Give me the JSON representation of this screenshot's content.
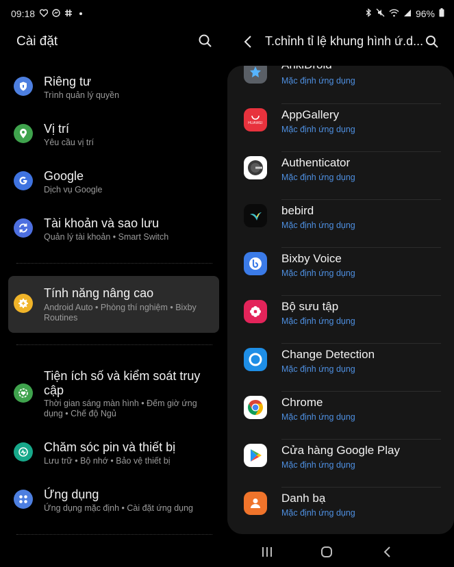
{
  "status": {
    "time": "09:18",
    "battery": "96%"
  },
  "left": {
    "title": "Cài đặt",
    "items": [
      {
        "title": "Riêng tư",
        "subtitle": "Trình quản lý quyền",
        "color": "#4d7fe0",
        "icon": "shield-icon"
      },
      {
        "title": "Vị trí",
        "subtitle": "Yêu cầu vị trí",
        "color": "#3fa34d",
        "icon": "location-pin-icon"
      },
      {
        "title": "Google",
        "subtitle": "Dịch vụ Google",
        "color": "#3f73e0",
        "icon": "google-icon"
      },
      {
        "title": "Tài khoản và sao lưu",
        "subtitle": "Quản lý tài khoản  •  Smart Switch",
        "color": "#4d6fe0",
        "icon": "sync-icon"
      },
      {
        "title": "Tính năng nâng cao",
        "subtitle1": "Android Auto  •  Phòng thí nghiệm  •  Bixby",
        "subtitle2": "Routines",
        "color": "#f0b429",
        "icon": "gear-plus-icon"
      },
      {
        "title1": "Tiện ích số và kiểm soát truy",
        "title2": "cập",
        "subtitle1": "Thời gian sáng màn hình  •  Đếm giờ ứng",
        "subtitle2": "dụng  •  Chế độ Ngủ",
        "color": "#3fa34d",
        "icon": "wellbeing-icon"
      },
      {
        "title": "Chăm sóc pin và thiết bị",
        "subtitle": "Lưu trữ  •  Bộ nhớ  •  Bảo vệ thiết bị",
        "color": "#17a88a",
        "icon": "device-care-icon"
      },
      {
        "title": "Ứng dụng",
        "subtitle": "Ứng dụng mặc định  •  Cài đặt ứng dụng",
        "color": "#4d7fe0",
        "icon": "apps-grid-icon"
      }
    ]
  },
  "right": {
    "title": "T.chỉnh tỉ lệ khung hình ứ.d...",
    "apps": [
      {
        "name": "AnkiDroid",
        "subtitle": "Mặc định ứng dụng",
        "icon": "ankidroid-icon",
        "bg": "#5a5f66"
      },
      {
        "name": "AppGallery",
        "subtitle": "Mặc định ứng dụng",
        "icon": "appgallery-icon",
        "bg": "#e8323d",
        "label": "HUAWEI"
      },
      {
        "name": "Authenticator",
        "subtitle": "Mặc định ứng dụng",
        "icon": "authenticator-icon",
        "bg": "#ffffff"
      },
      {
        "name": "bebird",
        "subtitle": "Mặc định ứng dụng",
        "icon": "bebird-icon",
        "bg": "#0a0a0a"
      },
      {
        "name": "Bixby Voice",
        "subtitle": "Mặc định ứng dụng",
        "icon": "bixby-icon",
        "bg": "#3b7be8"
      },
      {
        "name": "Bộ sưu tập",
        "subtitle": "Mặc định ứng dụng",
        "icon": "gallery-flower-icon",
        "bg": "#e3245a"
      },
      {
        "name": "Change Detection",
        "subtitle": "Mặc định ứng dụng",
        "icon": "change-detection-icon",
        "bg": "#1e8ee6"
      },
      {
        "name": "Chrome",
        "subtitle": "Mặc định ứng dụng",
        "icon": "chrome-icon",
        "bg": "#ffffff"
      },
      {
        "name": "Cửa hàng Google Play",
        "subtitle": "Mặc định ứng dụng",
        "icon": "play-store-icon",
        "bg": "#ffffff"
      },
      {
        "name": "Danh bạ",
        "subtitle": "Mặc định ứng dụng",
        "icon": "contacts-icon",
        "bg": "#f0742b"
      }
    ]
  }
}
